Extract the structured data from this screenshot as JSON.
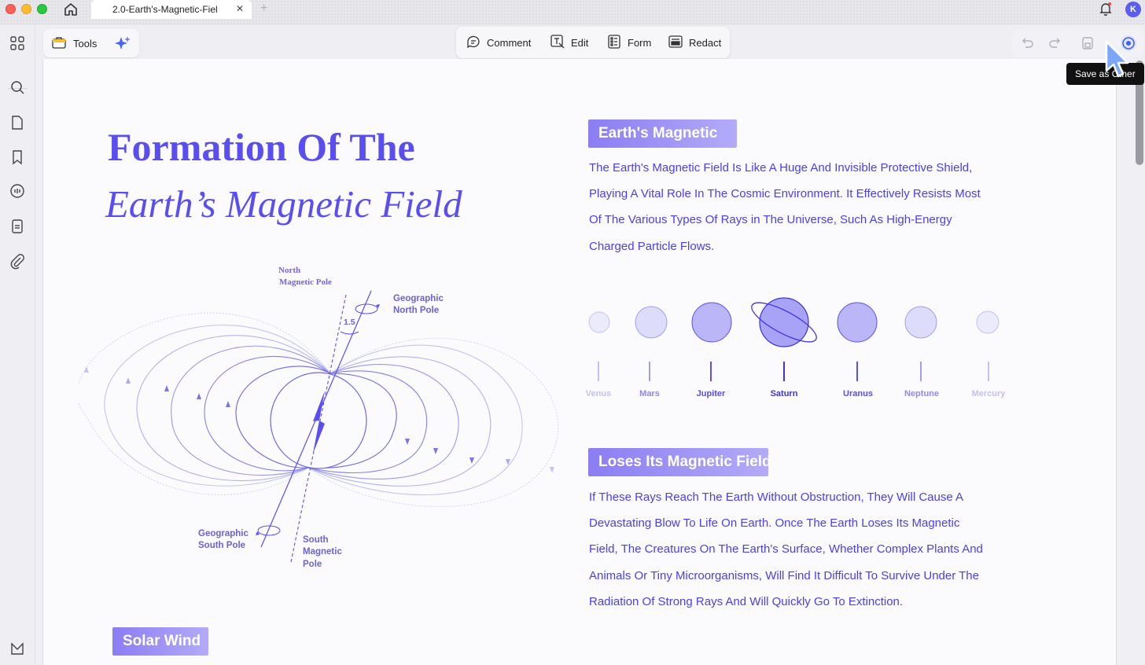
{
  "window": {
    "tab_title": "2.0-Earth's-Magnetic-Fiel",
    "tab_close": "✕",
    "tab_add": "+",
    "avatar_initial": "K"
  },
  "toolbar": {
    "tools_label": "Tools",
    "comment_label": "Comment",
    "edit_label": "Edit",
    "form_label": "Form",
    "redact_label": "Redact",
    "tooltip": "Save as Other"
  },
  "document": {
    "title_line1": "Formation Of The",
    "title_line2": "Earth’s Magnetic Field",
    "diagram_labels": {
      "north_magnetic_pole": [
        "North",
        "Magnetic Pole"
      ],
      "geographic_north_pole": [
        "Geographic",
        "North Pole"
      ],
      "angle": "1.5",
      "geographic_south_pole": [
        "Geographic",
        "South Pole"
      ],
      "south_magnetic_pole": [
        "South",
        "Magnetic",
        "Pole"
      ]
    },
    "section1": {
      "heading": "Earth's Magnetic",
      "lines": [
        "The Earth's Magnetic Field Is Like A Huge And Invisible Protective Shield,",
        "Playing A Vital Role In The Cosmic Environment. It Effectively Resists Most",
        "Of The Various Types Of Rays in The Universe, Such As High-Energy",
        "Charged Particle Flows."
      ]
    },
    "planets": [
      "Venus",
      "Mars",
      "Jupiter",
      "Saturn",
      "Uranus",
      "Neptune",
      "Mercury"
    ],
    "section2": {
      "heading": "Loses Its Magnetic Field",
      "lines": [
        "If These Rays Reach The Earth Without Obstruction, They Will Cause A",
        "Devastating Blow To Life On Earth. Once The Earth Loses Its Magnetic",
        "Field, The Creatures On The Earth's Surface, Whether Complex Plants And",
        "Animals Or Tiny Microorganisms, Will Find It Difficult To Survive Under The",
        "Radiation Of Strong Rays And Will Quickly Go To Extinction."
      ]
    },
    "section3": {
      "heading": "Solar Wind"
    }
  },
  "colors": {
    "accent": "#5a4ef0",
    "chip_start": "#8b7df3",
    "chip_end": "#b3abf8",
    "text_blue": "#4a3ff0"
  },
  "icons": [
    "home-icon",
    "bell-icon",
    "grid-icon",
    "search-icon",
    "page-icon",
    "bookmark-icon",
    "comment-list-icon",
    "document-icon",
    "attachment-icon",
    "brand-icon",
    "tools-icon",
    "ai-sparkle-icon",
    "comment-icon",
    "edit-icon",
    "form-icon",
    "redact-icon",
    "undo-icon",
    "redo-icon",
    "save-icon",
    "save-as-other-icon",
    "cursor-icon"
  ]
}
